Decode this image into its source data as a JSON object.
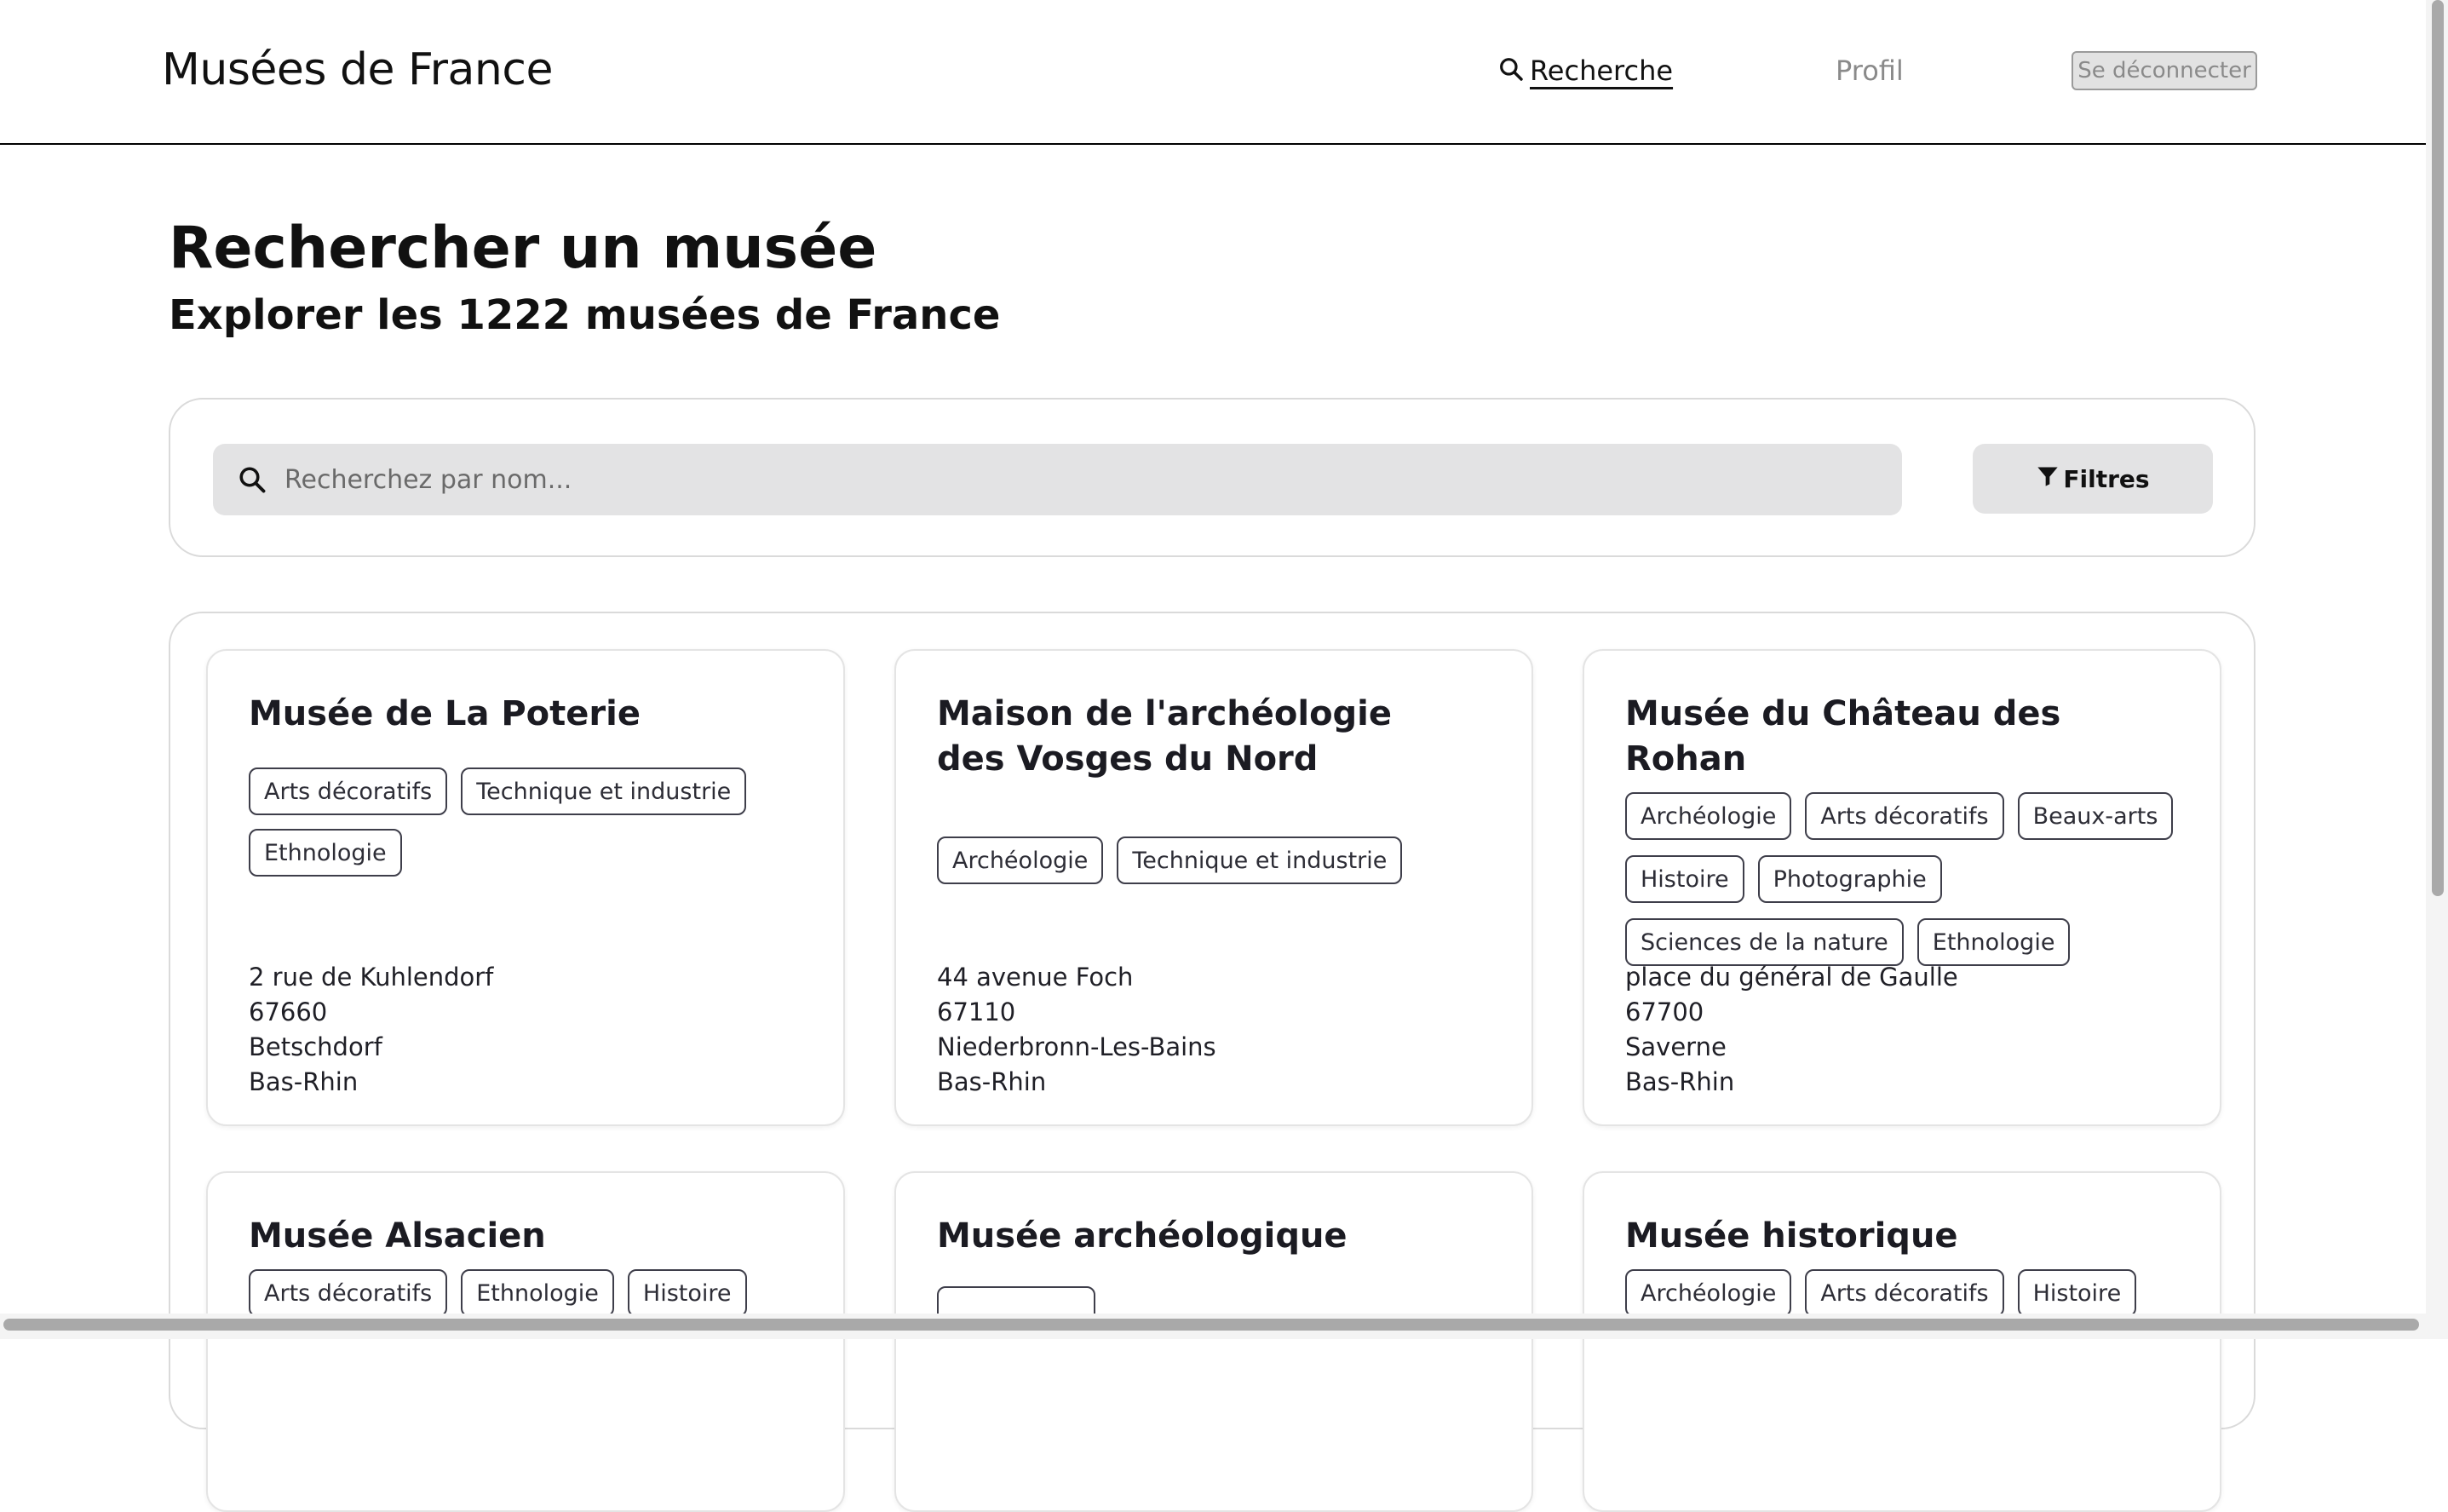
{
  "header": {
    "brand": "Musées de France",
    "nav": {
      "search_label": "Recherche",
      "profile_label": "Profil",
      "logout_label": "Se déconnecter"
    }
  },
  "page": {
    "title": "Rechercher un musée",
    "subtitle": "Explorer les 1222 musées de France"
  },
  "search": {
    "placeholder": "Recherchez par nom...",
    "value": "",
    "filters_label": "Filtres"
  },
  "museums": [
    {
      "name": "Musée de La Poterie",
      "tags": [
        "Arts décoratifs",
        "Technique et industrie",
        "Ethnologie"
      ],
      "address": [
        "2 rue de Kuhlendorf",
        "67660",
        "Betschdorf",
        "Bas-Rhin"
      ]
    },
    {
      "name": "Maison de l'archéologie des Vosges du Nord",
      "tags": [
        "Archéologie",
        "Technique et industrie"
      ],
      "address": [
        "44 avenue Foch",
        "67110",
        "Niederbronn-Les-Bains",
        "Bas-Rhin"
      ]
    },
    {
      "name": "Musée du Château des Rohan",
      "tags": [
        "Archéologie",
        "Arts décoratifs",
        "Beaux-arts",
        "Histoire",
        "Photographie",
        "Sciences de la nature",
        "Ethnologie"
      ],
      "address": [
        "place du général de Gaulle",
        "67700",
        "Saverne",
        "Bas-Rhin"
      ]
    },
    {
      "name": "Musée Alsacien",
      "tags": [
        "Arts décoratifs",
        "Ethnologie",
        "Histoire"
      ],
      "address": []
    },
    {
      "name": "Musée archéologique",
      "tags": [],
      "address": []
    },
    {
      "name": "Musée historique",
      "tags": [
        "Archéologie",
        "Arts décoratifs",
        "Histoire"
      ],
      "address": []
    }
  ]
}
